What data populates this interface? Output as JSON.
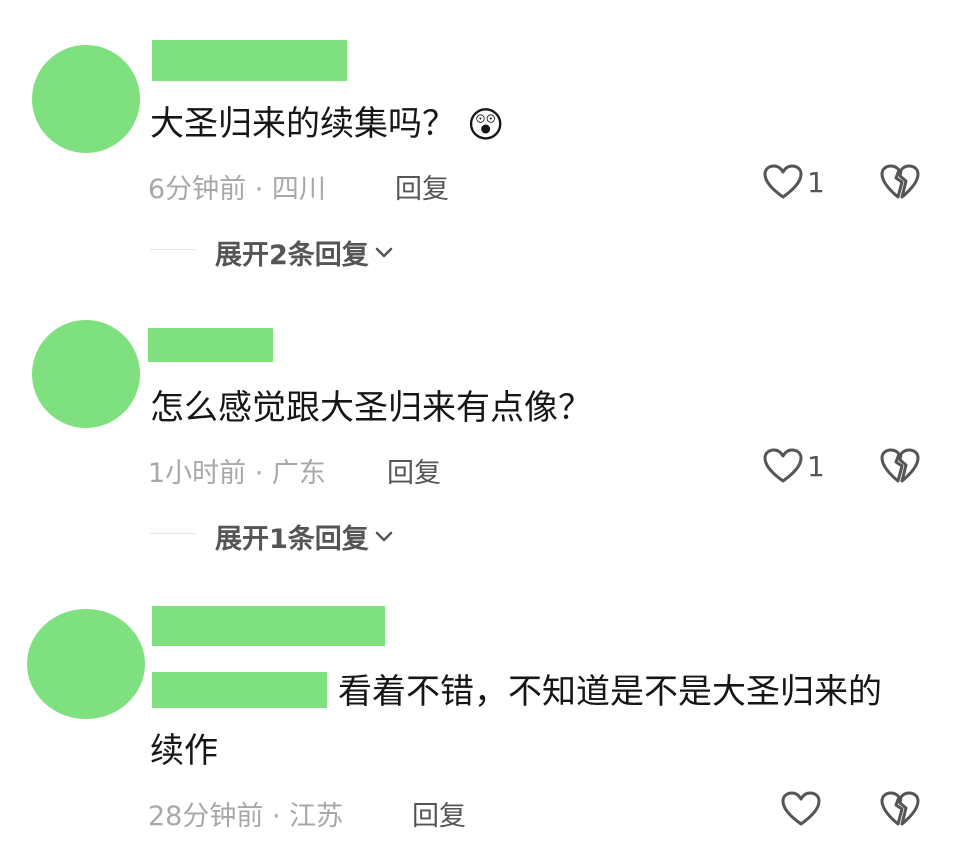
{
  "comments": [
    {
      "text": "大圣归来的续集吗？",
      "emoji": "😲",
      "time_location": "6分钟前 · 四川",
      "reply_label": "回复",
      "like_count": "1",
      "expand_label": "展开2条回复"
    },
    {
      "text": "怎么感觉跟大圣归来有点像？",
      "time_location": "1小时前 · 广东",
      "reply_label": "回复",
      "like_count": "1",
      "expand_label": "展开1条回复"
    },
    {
      "text_line1": "看着不错，不知道是不是大圣归来的",
      "text_line2": "续作",
      "time_location": "28分钟前 · 江苏",
      "reply_label": "回复"
    }
  ],
  "colors": {
    "redaction": "#7fe07f",
    "meta_gray": "#a8a8a8",
    "icon_gray": "#555555"
  },
  "icons": {
    "like": "heart-outline-icon",
    "dislike": "broken-heart-icon",
    "expand": "chevron-down-icon"
  }
}
